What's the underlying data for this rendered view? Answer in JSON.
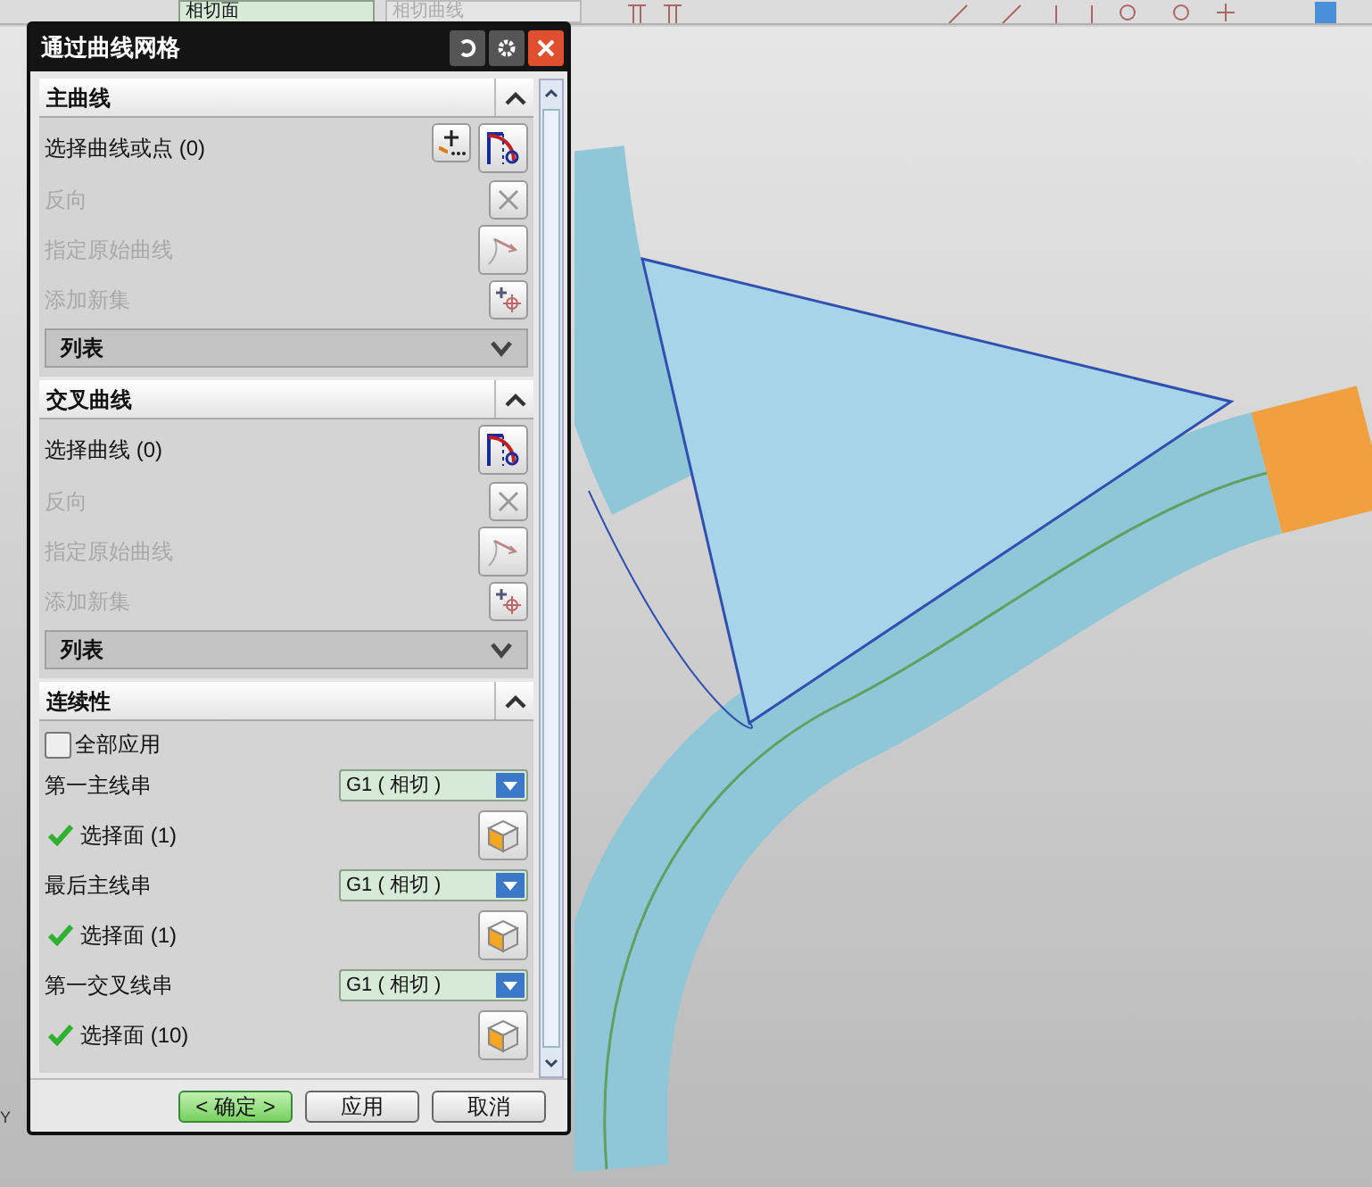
{
  "toolbar": {
    "dropdowns": [
      {
        "value": "相切面",
        "disabled": false
      },
      {
        "value": "相切曲线",
        "disabled": true
      }
    ]
  },
  "dialog": {
    "title": "通过曲线网格",
    "sections": [
      {
        "title": "主曲线",
        "expanded": true,
        "rows": [
          {
            "kind": "select_point",
            "label": "选择曲线或点 (0)",
            "disabled": false
          },
          {
            "kind": "reverse",
            "label": "反向",
            "disabled": true
          },
          {
            "kind": "origin",
            "label": "指定原始曲线",
            "disabled": true
          },
          {
            "kind": "addset",
            "label": "添加新集",
            "disabled": true
          },
          {
            "kind": "list",
            "label": "列表"
          }
        ]
      },
      {
        "title": "交叉曲线",
        "expanded": true,
        "rows": [
          {
            "kind": "select",
            "label": "选择曲线 (0)",
            "disabled": false
          },
          {
            "kind": "reverse",
            "label": "反向",
            "disabled": true
          },
          {
            "kind": "origin",
            "label": "指定原始曲线",
            "disabled": true
          },
          {
            "kind": "addset",
            "label": "添加新集",
            "disabled": true
          },
          {
            "kind": "list",
            "label": "列表"
          }
        ]
      },
      {
        "title": "连续性",
        "expanded": true,
        "rows": [
          {
            "kind": "checkbox",
            "label": "全部应用",
            "checked": false
          },
          {
            "kind": "dropdown",
            "label": "第一主线串",
            "value": "G1 ( 相切 )"
          },
          {
            "kind": "face",
            "label": "选择面 (1)",
            "done": true
          },
          {
            "kind": "dropdown",
            "label": "最后主线串",
            "value": "G1 ( 相切 )"
          },
          {
            "kind": "face",
            "label": "选择面 (1)",
            "done": true
          },
          {
            "kind": "dropdown",
            "label": "第一交叉线串",
            "value": "G1 ( 相切 )"
          },
          {
            "kind": "face",
            "label": "选择面 (10)",
            "done": true
          }
        ]
      }
    ],
    "buttons": [
      {
        "label": "< 确定 >",
        "primary": true
      },
      {
        "label": "应用",
        "primary": false
      },
      {
        "label": "取消",
        "primary": false
      }
    ]
  },
  "axis_label": "Y"
}
